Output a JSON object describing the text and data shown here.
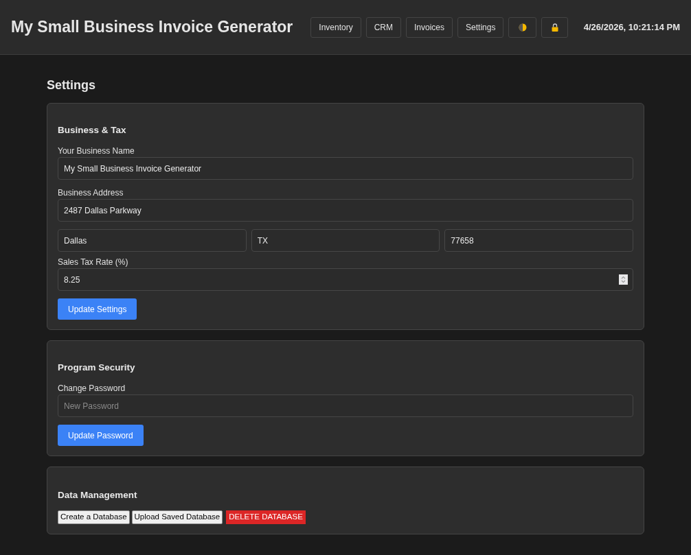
{
  "header": {
    "title": "My Small Business Invoice Generator",
    "nav": [
      "Inventory",
      "CRM",
      "Invoices",
      "Settings"
    ],
    "datetime": "4/26/2026, 10:21:14 PM"
  },
  "page_title": "Settings",
  "business_tax": {
    "title": "Business & Tax",
    "business_name": {
      "label": "Your Business Name",
      "value": "My Small Business Invoice Generator"
    },
    "business_address": {
      "label": "Business Address",
      "value": "2487 Dallas Parkway"
    },
    "city": {
      "value": "Dallas"
    },
    "state": {
      "value": "TX"
    },
    "zip": {
      "value": "77658"
    },
    "sales_tax_rate": {
      "label": "Sales Tax Rate (%)",
      "value": "8.25"
    },
    "button": "Update Settings"
  },
  "program_security": {
    "title": "Program Security",
    "change_password": {
      "label": "Change Password",
      "placeholder": "New Password"
    },
    "button": "Update Password"
  },
  "data_management": {
    "title": "Data Management",
    "buttons": [
      {
        "label": "Create a Database",
        "kind": "default"
      },
      {
        "label": "Upload Saved Database",
        "kind": "default"
      },
      {
        "label": "DELETE DATABASE",
        "kind": "danger"
      }
    ]
  }
}
